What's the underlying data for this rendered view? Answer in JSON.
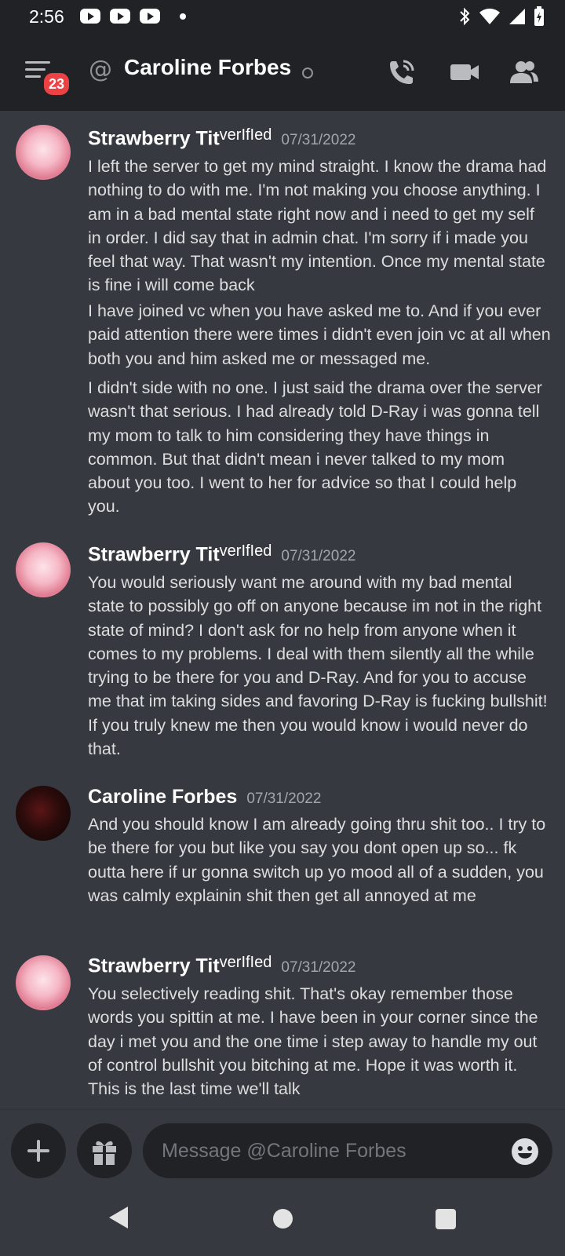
{
  "status_bar": {
    "time": "2:56"
  },
  "header": {
    "badge_count": "23",
    "at_symbol": "@",
    "channel_name": "Caroline Forbes"
  },
  "messages": [
    {
      "author": "Strawberry  Tit",
      "verified": "verIfIed",
      "timestamp": "07/31/2022",
      "paragraphs": [
        "I left the server to get my mind straight. I know the drama had nothing to do with me. I'm not making you choose anything. I am in a bad mental state right now and i need to get my self in order. I did say that in admin chat. I'm sorry if i made you feel that way. That wasn't my intention. Once my mental state is fine i will come back",
        "I have joined vc when you have asked me to. And if you ever paid attention there were times i didn't even join vc at all when both you and him asked me or messaged me.",
        "I didn't side with no one. I just said the drama over the server wasn't that serious. I had already told D-Ray i was gonna tell my mom to talk to him considering they have things in common. But that didn't mean i never talked to my mom about you too. I went to her for advice so that I could help you."
      ]
    },
    {
      "author": "Strawberry  Tit",
      "verified": "verIfIed",
      "timestamp": "07/31/2022",
      "paragraphs": [
        "You would seriously want me around with my bad mental state to possibly go off on anyone because im not in the right state of mind? I don't ask for no help from anyone when it comes to my problems. I deal with them silently all the while trying to be there for you and D-Ray. And for you to accuse me that im taking sides and favoring D-Ray is fucking bullshit! If you truly knew me then you would know i would never do that."
      ]
    },
    {
      "author": "Caroline Forbes",
      "verified": "",
      "timestamp": "07/31/2022",
      "paragraphs": [
        "And you should know I am already going thru shit too.. I try to be there for you but like you say you dont open up so... fk outta here if ur gonna switch up yo mood all of a sudden, you was calmly explainin shit then get all annoyed at me"
      ]
    },
    {
      "author": "Strawberry  Tit",
      "verified": "verIfIed",
      "timestamp": "07/31/2022",
      "paragraphs": [
        "You selectively reading shit. That's okay remember those words you spittin at me. I have been in your corner since the day i met you and the one time i step away to handle my out of control bullshit you bitching at me. Hope it was worth it. This is the last time we'll talk"
      ]
    }
  ],
  "composer": {
    "placeholder": "Message @Caroline Forbes"
  }
}
